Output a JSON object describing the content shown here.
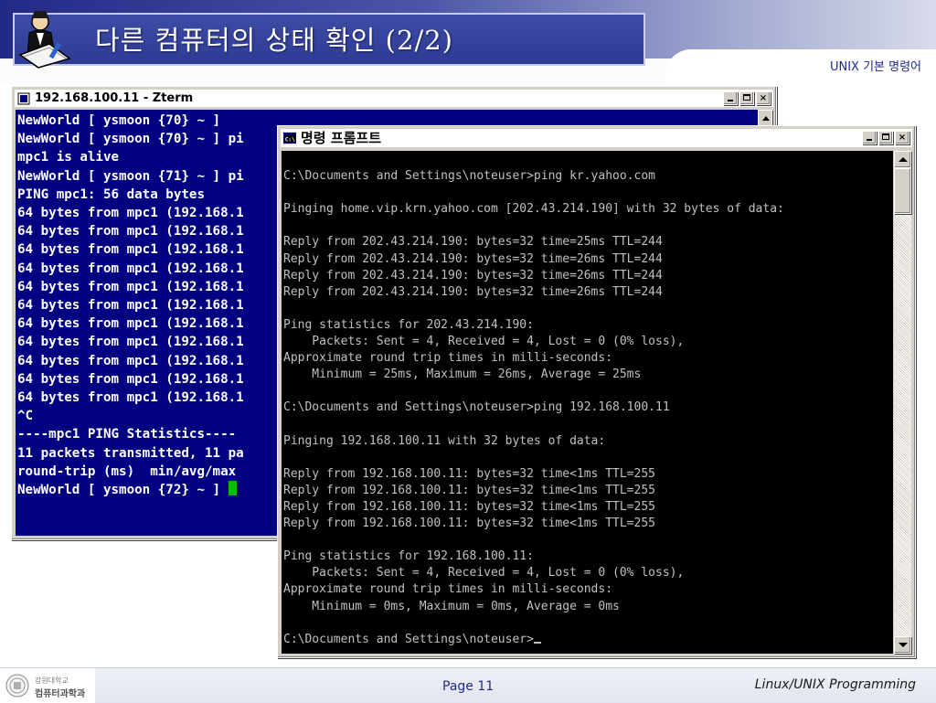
{
  "slide": {
    "title": "다른 컴퓨터의 상태 확인 (2/2)",
    "subtitle": "UNIX 기본 명령어"
  },
  "zterm": {
    "title": "192.168.100.11 - Zterm",
    "lines": [
      "NewWorld [ ysmoon {70} ~ ]",
      "NewWorld [ ysmoon {70} ~ ] pi",
      "mpc1 is alive",
      "NewWorld [ ysmoon {71} ~ ] pi",
      "PING mpc1: 56 data bytes",
      "64 bytes from mpc1 (192.168.1",
      "64 bytes from mpc1 (192.168.1",
      "64 bytes from mpc1 (192.168.1",
      "64 bytes from mpc1 (192.168.1",
      "64 bytes from mpc1 (192.168.1",
      "64 bytes from mpc1 (192.168.1",
      "64 bytes from mpc1 (192.168.1",
      "64 bytes from mpc1 (192.168.1",
      "64 bytes from mpc1 (192.168.1",
      "64 bytes from mpc1 (192.168.1",
      "64 bytes from mpc1 (192.168.1",
      "^C",
      "----mpc1 PING Statistics----",
      "11 packets transmitted, 11 pa",
      "round-trip (ms)  min/avg/max",
      "NewWorld [ ysmoon {72} ~ ] "
    ]
  },
  "cmd": {
    "title": "명령 프롬프트",
    "icon_label": "C:\\",
    "lines": [
      "",
      "C:\\Documents and Settings\\noteuser>ping kr.yahoo.com",
      "",
      "Pinging home.vip.krn.yahoo.com [202.43.214.190] with 32 bytes of data:",
      "",
      "Reply from 202.43.214.190: bytes=32 time=25ms TTL=244",
      "Reply from 202.43.214.190: bytes=32 time=26ms TTL=244",
      "Reply from 202.43.214.190: bytes=32 time=26ms TTL=244",
      "Reply from 202.43.214.190: bytes=32 time=26ms TTL=244",
      "",
      "Ping statistics for 202.43.214.190:",
      "    Packets: Sent = 4, Received = 4, Lost = 0 (0% loss),",
      "Approximate round trip times in milli-seconds:",
      "    Minimum = 25ms, Maximum = 26ms, Average = 25ms",
      "",
      "C:\\Documents and Settings\\noteuser>ping 192.168.100.11",
      "",
      "Pinging 192.168.100.11 with 32 bytes of data:",
      "",
      "Reply from 192.168.100.11: bytes=32 time<1ms TTL=255",
      "Reply from 192.168.100.11: bytes=32 time<1ms TTL=255",
      "Reply from 192.168.100.11: bytes=32 time<1ms TTL=255",
      "Reply from 192.168.100.11: bytes=32 time<1ms TTL=255",
      "",
      "Ping statistics for 192.168.100.11:",
      "    Packets: Sent = 4, Received = 4, Lost = 0 (0% loss),",
      "Approximate round trip times in milli-seconds:",
      "    Minimum = 0ms, Maximum = 0ms, Average = 0ms",
      "",
      "C:\\Documents and Settings\\noteuser>"
    ]
  },
  "window_buttons": {
    "minimize": "_",
    "maximize": "□",
    "close": "×"
  },
  "footer": {
    "university": "강원대학교",
    "department": "컴퓨터과학과",
    "page": "Page 11",
    "course": "Linux/UNIX Programming"
  },
  "colors": {
    "zterm_bg": "#000080",
    "cmd_bg": "#000000",
    "title_blue": "#2e3b93",
    "accent_text": "#1e2a8c"
  }
}
